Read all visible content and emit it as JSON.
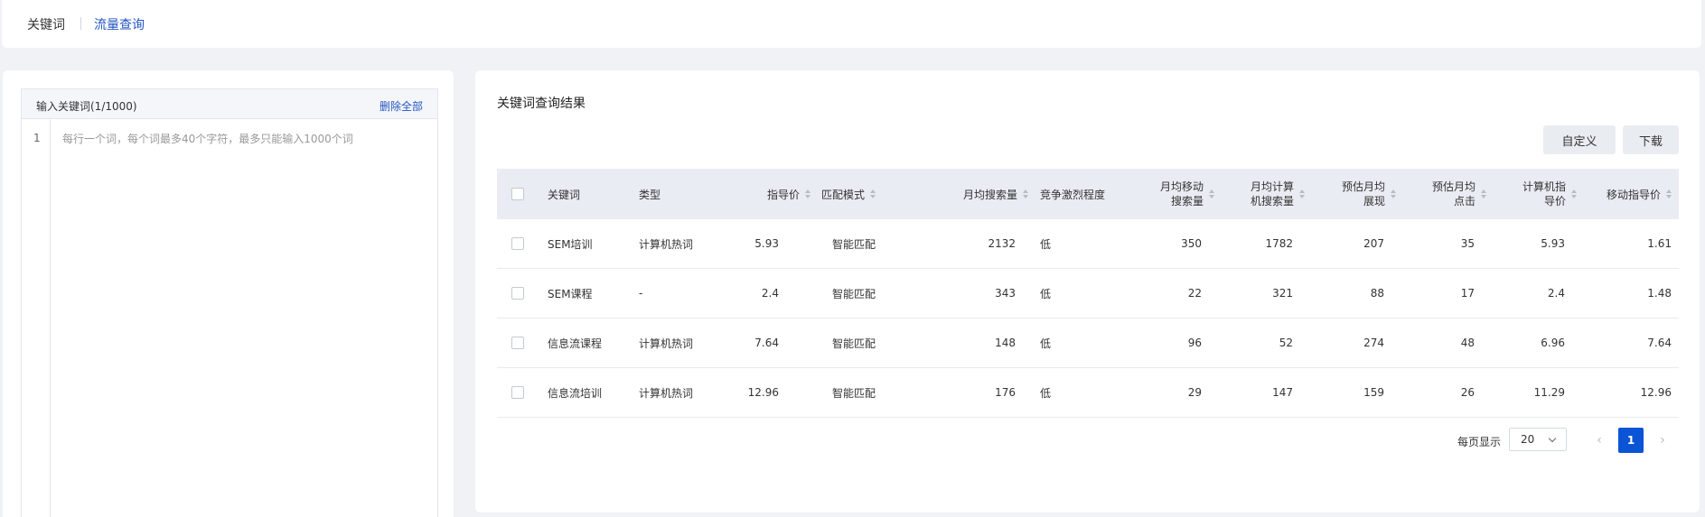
{
  "tabs": [
    {
      "label": "关键词",
      "active": false
    },
    {
      "label": "流量查询",
      "active": true
    }
  ],
  "keyword_panel": {
    "title": "输入关键词(1/1000)",
    "delete_all": "删除全部",
    "line_number": "1",
    "placeholder": "每行一个词，每个词最多40个字符，最多只能输入1000个词"
  },
  "results": {
    "title": "关键词查询结果",
    "custom_button": "自定义",
    "download_button": "下载",
    "headers": {
      "keyword": "关键词",
      "type": "类型",
      "bid": "指导价",
      "match": "匹配模式",
      "monthly_search": "月均搜索量",
      "competition": "竞争激烈程度",
      "mobile_search": "月均移动搜索量",
      "pc_search": "月均计算机搜索量",
      "est_impr": "预估月均展现",
      "est_clicks": "预估月均点击",
      "pc_bid": "计算机指导价",
      "mobile_bid": "移动指导价"
    },
    "rows": [
      {
        "keyword": "SEM培训",
        "type": "计算机热词",
        "bid": "5.93",
        "match": "智能匹配",
        "monthly_search": "2132",
        "competition": "低",
        "mobile_search": "350",
        "pc_search": "1782",
        "est_impr": "207",
        "est_clicks": "35",
        "pc_bid": "5.93",
        "mobile_bid": "1.61"
      },
      {
        "keyword": "SEM课程",
        "type": "-",
        "bid": "2.4",
        "match": "智能匹配",
        "monthly_search": "343",
        "competition": "低",
        "mobile_search": "22",
        "pc_search": "321",
        "est_impr": "88",
        "est_clicks": "17",
        "pc_bid": "2.4",
        "mobile_bid": "1.48"
      },
      {
        "keyword": "信息流课程",
        "type": "计算机热词",
        "bid": "7.64",
        "match": "智能匹配",
        "monthly_search": "148",
        "competition": "低",
        "mobile_search": "96",
        "pc_search": "52",
        "est_impr": "274",
        "est_clicks": "48",
        "pc_bid": "6.96",
        "mobile_bid": "7.64"
      },
      {
        "keyword": "信息流培训",
        "type": "计算机热词",
        "bid": "12.96",
        "match": "智能匹配",
        "monthly_search": "176",
        "competition": "低",
        "mobile_search": "29",
        "pc_search": "147",
        "est_impr": "159",
        "est_clicks": "26",
        "pc_bid": "11.29",
        "mobile_bid": "12.96"
      }
    ]
  },
  "pagination": {
    "per_page_label": "每页显示",
    "per_page_value": "20",
    "prev": "‹",
    "current_page": "1",
    "next": "›"
  },
  "colors": {
    "accent": "#2455c3",
    "page_active": "#0b54d6",
    "header_bg": "#e9ecf3",
    "page_bg": "#f0f2f5"
  }
}
